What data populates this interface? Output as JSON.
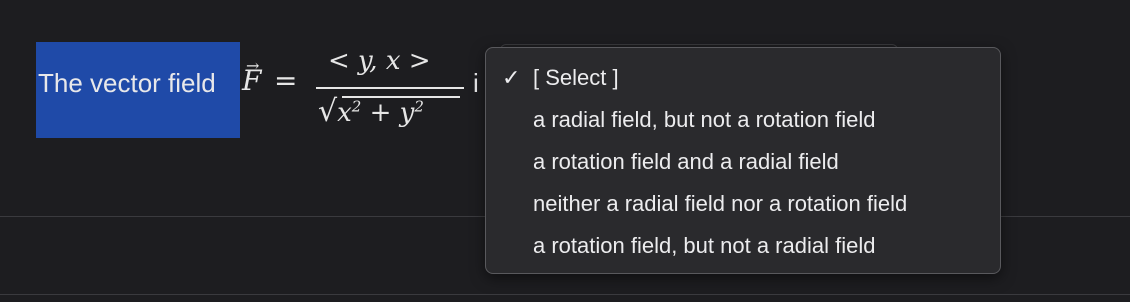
{
  "question": {
    "prefix": "The vector field",
    "field_symbol": "F",
    "arrow": "→",
    "equals": "=",
    "numerator": "< y, x >",
    "denominator_radical": "√",
    "denominator_expr_a": "x",
    "denominator_sup_a": "2",
    "denominator_plus": " + ",
    "denominator_expr_b": "y",
    "denominator_sup_b": "2",
    "trailing_text": "i"
  },
  "dropdown": {
    "check_glyph": "✓",
    "options": [
      {
        "label": "[ Select ]",
        "selected": true
      },
      {
        "label": "a radial field, but not a rotation field",
        "selected": false
      },
      {
        "label": "a rotation field and a radial field",
        "selected": false
      },
      {
        "label": "neither a radial field nor a rotation field",
        "selected": false
      },
      {
        "label": "a rotation field, but not a radial field",
        "selected": false
      }
    ]
  },
  "colors": {
    "background": "#1d1d20",
    "highlight": "#1f4aa8",
    "menu_background": "#2a2a2d",
    "menu_border": "#59595d",
    "text": "#ececee"
  }
}
